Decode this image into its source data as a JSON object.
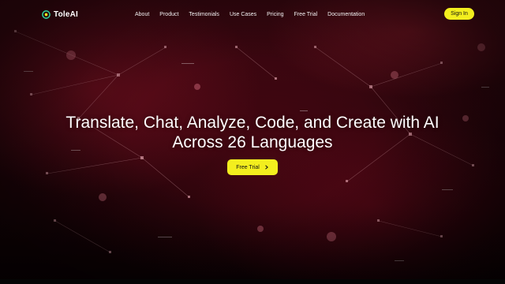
{
  "brand": {
    "name": "ToleAI",
    "logo_icon": "tole-logo-icon"
  },
  "nav": {
    "links": [
      "About",
      "Product",
      "Testimonials",
      "Use Cases",
      "Pricing",
      "Free Trial",
      "Documentation"
    ],
    "signin_label": "Sign In"
  },
  "hero": {
    "headline_line1": "Translate, Chat, Analyze, Code, and Create with AI",
    "headline_line2": "Across 26 Languages",
    "cta_label": "Free Trial",
    "cta_icon": "chevron-right-icon"
  },
  "colors": {
    "accent": "#f3ee1e",
    "background": "#2a050c",
    "text": "#ffffff"
  }
}
